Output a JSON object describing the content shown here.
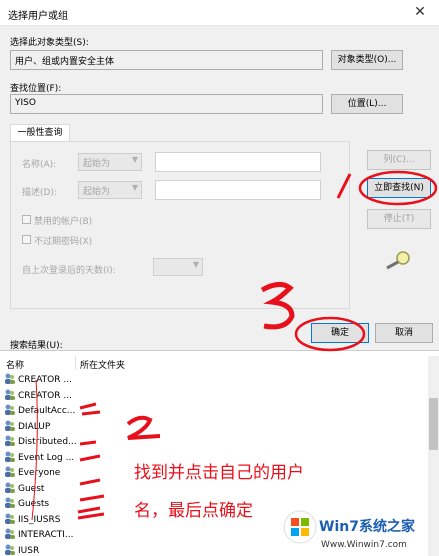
{
  "window": {
    "title": "选择用户或组",
    "close_glyph": "✕"
  },
  "object_type": {
    "label": "选择此对象类型(S):",
    "value": "用户、组或内置安全主体",
    "button": "对象类型(O)..."
  },
  "location": {
    "label": "查找位置(F):",
    "value": "YISO",
    "button": "位置(L)..."
  },
  "tab": {
    "label": "一般性查询"
  },
  "query": {
    "name_label": "名称(A):",
    "name_mode": "起始为",
    "desc_label": "描述(D):",
    "desc_mode": "起始为",
    "disabled_accounts": "禁用的帐户(B)",
    "no_expire_pwd": "不过期密码(X)",
    "days_label": "自上次登录后的天数(I):"
  },
  "buttons": {
    "columns": "列(C)...",
    "find_now": "立即查找(N)",
    "stop": "停止(T)",
    "ok": "确定",
    "cancel": "取消"
  },
  "results": {
    "label": "搜索结果(U):",
    "columns": [
      "名称",
      "所在文件夹"
    ],
    "rows": [
      "CREATOR ...",
      "CREATOR ...",
      "DefaultAcc...",
      "DIALUP",
      "Distributed...",
      "Event Log ...",
      "Everyone",
      "Guest",
      "Guests",
      "IIS_IUSRS",
      "INTERACTI...",
      "IUSR"
    ]
  },
  "annotations": {
    "step1": "1",
    "step2": "2",
    "step3": "3",
    "note_line1": "找到并点击自己的用户",
    "note_line2": "名，最后点确定"
  },
  "watermark": {
    "logo": "Win7系统之家",
    "url": "Www.Winwin7.com"
  },
  "colors": {
    "annotation_red": "#e8101a",
    "focus_blue": "#0078d7",
    "dialog_bg": "#f0f0f0"
  }
}
